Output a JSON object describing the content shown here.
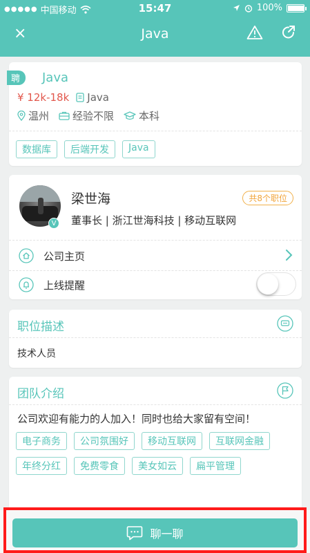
{
  "status": {
    "carrier": "中国移动",
    "time": "15:47",
    "battery": "100%"
  },
  "nav": {
    "close_label": "×",
    "title": "Java"
  },
  "job": {
    "badge": "聘",
    "title": "Java",
    "salary": "¥ 12k-18k",
    "category": "Java",
    "city": "温州",
    "experience": "经验不限",
    "education": "本科",
    "tags": [
      "数据库",
      "后端开发",
      "Java"
    ]
  },
  "contact": {
    "name": "梁世海",
    "jobs_count": "共8个职位",
    "info": "董事长 | 浙江世海科技 | 移动互联网",
    "verified_label": "V",
    "company_home": "公司主页",
    "online_reminder": "上线提醒",
    "reminder_on": false
  },
  "description": {
    "title": "职位描述",
    "text": "技术人员"
  },
  "team": {
    "title": "团队介绍",
    "text": "公司欢迎有能力的人加入！同时也给大家留有空间！",
    "tags": [
      "电子商务",
      "公司氛围好",
      "移动互联网",
      "互联网金融",
      "年终分红",
      "免费零食",
      "美女如云",
      "扁平管理"
    ]
  },
  "bottom": {
    "chat_label": "聊一聊"
  },
  "colors": {
    "accent": "#57c5b9",
    "salary": "#e2574c",
    "badge_orange": "#f1a43a",
    "highlight": "#ff1a1a"
  }
}
